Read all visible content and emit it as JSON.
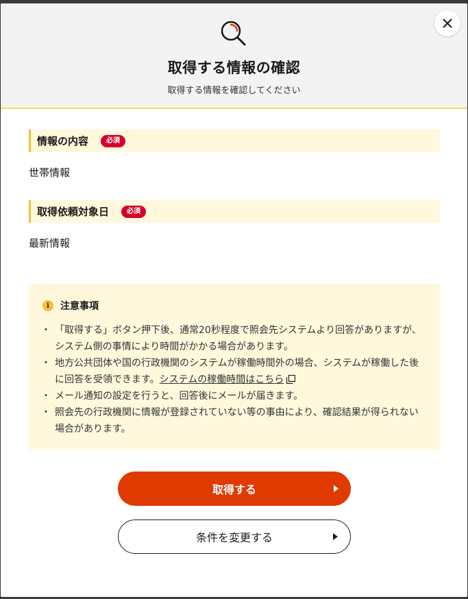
{
  "header": {
    "icon": "search-icon",
    "title": "取得する情報の確認",
    "subtitle": "取得する情報を確認してください",
    "close_icon": "close-icon"
  },
  "fields": [
    {
      "label": "情報の内容",
      "badge": "必須",
      "value": "世帯情報"
    },
    {
      "label": "取得依頼対象日",
      "badge": "必須",
      "value": "最新情報"
    }
  ],
  "notice": {
    "icon": "info-icon",
    "title": "注意事項",
    "items": [
      "「取得する」ボタン押下後、通常20秒程度で照会先システムより回答がありますが、システム側の事情により時間がかかる場合があります。",
      "地方公共団体や国の行政機関のシステムが稼働時間外の場合、システムが稼働した後に回答を受領できます。",
      "メール通知の設定を行うと、回答後にメールが届きます。",
      "照会先の行政機関に情報が登録されていない等の事由により、確認結果が得られない場合があります。"
    ],
    "link_text": "システムの稼働時間はこちら",
    "link_icon": "external-link-icon"
  },
  "buttons": {
    "primary_label": "取得する",
    "secondary_label": "条件を変更する"
  },
  "colors": {
    "primary": "#e03a00",
    "accent_yellow": "#f1c232",
    "label_bg": "#fff8dd",
    "badge_red": "#d6002a",
    "header_bg": "#f3f3f3"
  }
}
